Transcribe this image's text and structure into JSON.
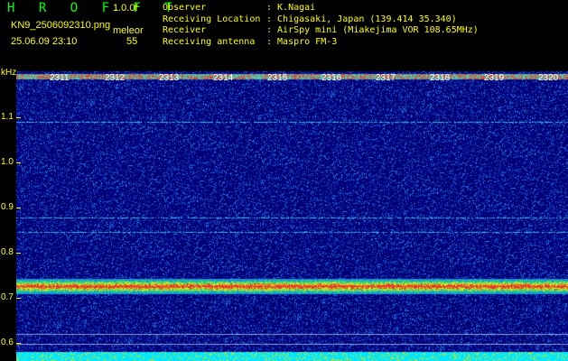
{
  "header": {
    "logo": "H R O F F T",
    "version": "1.0.0f",
    "filename": "KN9_2506092310.png",
    "meleor_label": "meleor",
    "datetime": "25.06.09 23:10",
    "count": "55"
  },
  "info": [
    {
      "key": "Observer",
      "value": ": K.Nagai"
    },
    {
      "key": "Receiving Location",
      "value": ": Chigasaki, Japan (139.414 35.340)"
    },
    {
      "key": "Receiver",
      "value": ": AirSpy mini (Miakejima VOR 108.65MHz)"
    },
    {
      "key": "Receiving antenna",
      "value": ": Maspro FM-3"
    }
  ],
  "axis": {
    "unit": "kHz",
    "y_ticks": [
      "1.1",
      "1.0",
      "0.9",
      "0.8",
      "0.7",
      "0.6"
    ],
    "minute_labels": [
      "2311",
      "2312",
      "2313",
      "2314",
      "2315",
      "2316",
      "2317",
      "2318",
      "2319",
      "2320"
    ]
  },
  "colors": {
    "label": "#ffff00",
    "logo": "#00ff00",
    "background": "#000080"
  }
}
